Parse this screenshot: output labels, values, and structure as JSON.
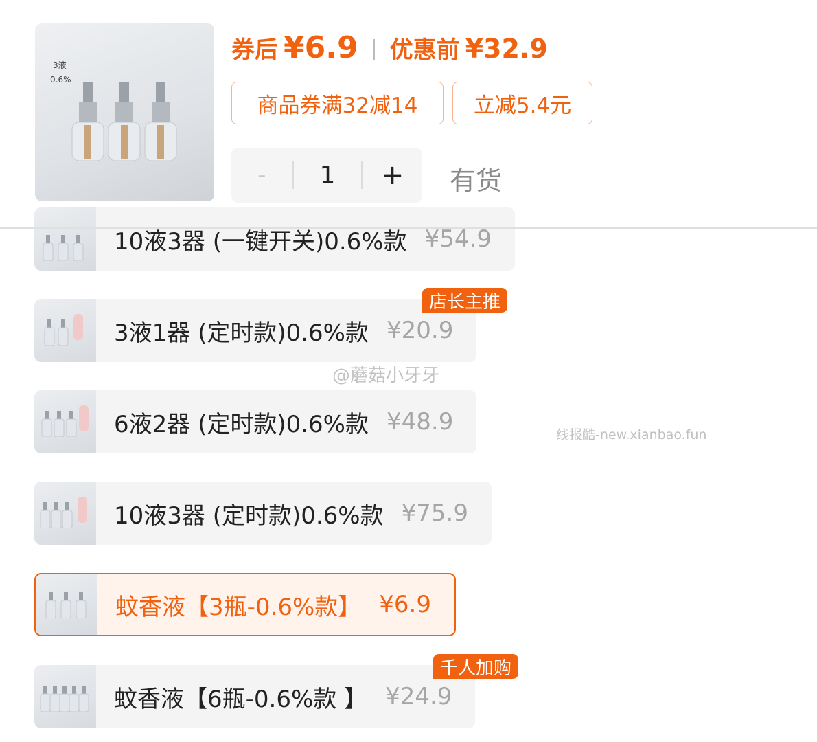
{
  "product": {
    "image_tag_line1": "3液",
    "image_tag_line2": "0.6%",
    "coupon_price_label": "券后",
    "coupon_price": "¥6.9",
    "original_price_label": "优惠前",
    "original_price": "¥32.9"
  },
  "coupons": [
    "商品券满32减14",
    "立减5.4元"
  ],
  "quantity": {
    "minus": "-",
    "value": "1",
    "plus": "+",
    "stock_status": "有货"
  },
  "skus": [
    {
      "name": "10液3器 (一键开关)0.6%款",
      "price": "¥54.9",
      "badge": "",
      "selected": false
    },
    {
      "name": "3液1器 (定时款)0.6%款",
      "price": "¥20.9",
      "badge": "店长主推",
      "selected": false
    },
    {
      "name": "6液2器 (定时款)0.6%款",
      "price": "¥48.9",
      "badge": "",
      "selected": false
    },
    {
      "name": "10液3器 (定时款)0.6%款",
      "price": "¥75.9",
      "badge": "",
      "selected": false
    },
    {
      "name": "蚊香液【3瓶-0.6%款】",
      "price": "¥6.9",
      "badge": "",
      "selected": true
    },
    {
      "name": "蚊香液【6瓶-0.6%款 】",
      "price": "¥24.9",
      "badge": "千人加购",
      "selected": false
    }
  ],
  "watermarks": {
    "weibo": "@蘑菇小牙牙",
    "site": "线报酷-new.xianbao.fun"
  },
  "colors": {
    "accent": "#f0620f",
    "coupon_border": "#f6b48f",
    "selected_bg": "#fff3ec",
    "sku_bg": "#f4f4f4",
    "muted_price": "#a6a6a6"
  }
}
